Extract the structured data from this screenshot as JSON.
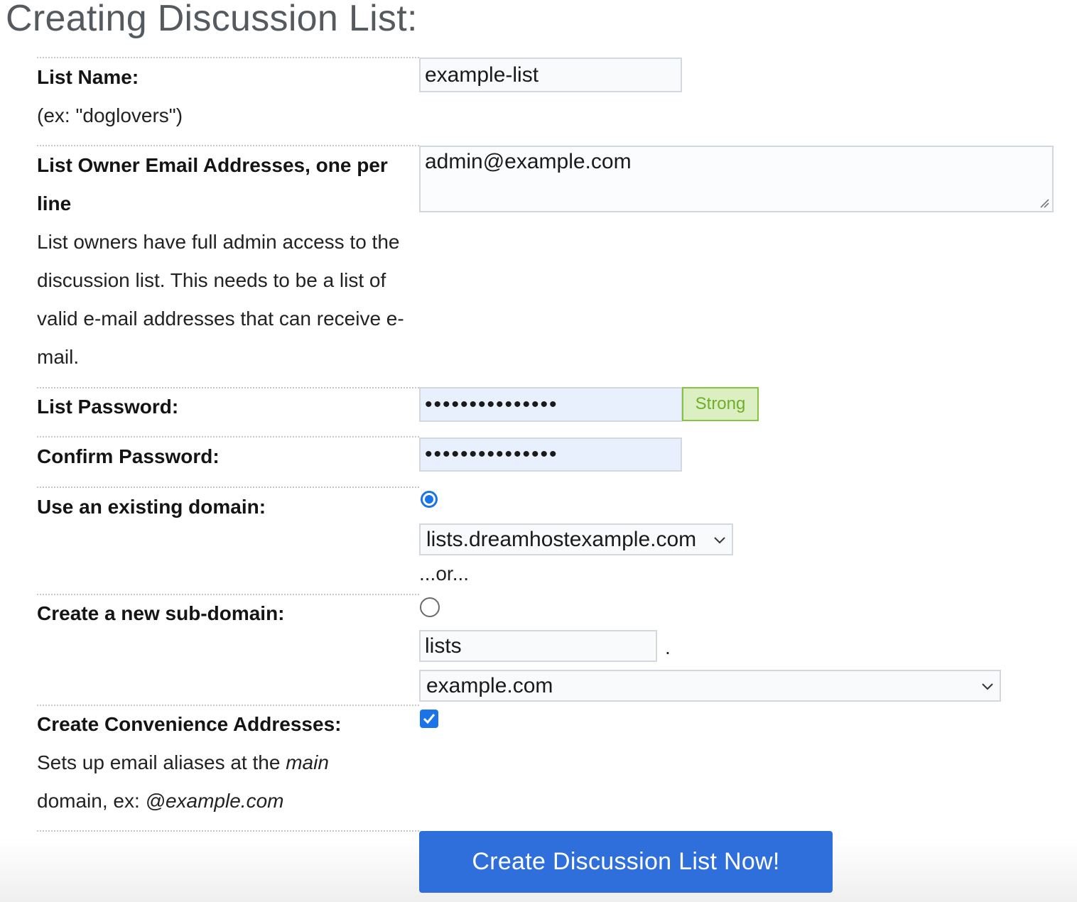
{
  "page_title": "Creating Discussion List:",
  "list_name": {
    "label": "List Name:",
    "help": "(ex: \"doglovers\")",
    "value": "example-list"
  },
  "owners": {
    "label": "List Owner Email Addresses, one per line",
    "help": "List owners have full admin access to the discussion list. This needs to be a list of valid e-mail addresses that can receive e-mail.",
    "value": "admin@example.com"
  },
  "password": {
    "label": "List Password:",
    "value": "•••••••••••••••",
    "strength": "Strong"
  },
  "confirm_password": {
    "label": "Confirm Password:",
    "value": "•••••••••••••••"
  },
  "existing_domain": {
    "label": "Use an existing domain:",
    "selected": true,
    "select_value": "lists.dreamhostexample.com",
    "or_text": "...or..."
  },
  "new_subdomain": {
    "label": "Create a new sub-domain:",
    "selected": false,
    "subdomain_value": "lists",
    "dot": ".",
    "domain_select_value": "example.com"
  },
  "convenience": {
    "label": "Create Convenience Addresses:",
    "checked": true,
    "help_prefix": "Sets up email aliases at the ",
    "help_em1": "main",
    "help_mid": "domain, ex: ",
    "help_em2": "@example.com"
  },
  "submit_label": "Create Discussion List Now!",
  "colors": {
    "accent": "#2f6fdc",
    "radio": "#1a73e8",
    "strong_bg": "#dcefc3",
    "strong_text": "#6fae2a"
  }
}
